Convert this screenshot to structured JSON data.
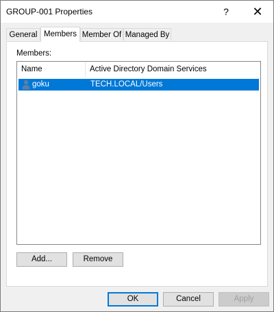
{
  "window": {
    "title": "GROUP-001 Properties",
    "help_label": "?",
    "close_label": "✕"
  },
  "tabs": [
    {
      "label": "General"
    },
    {
      "label": "Members"
    },
    {
      "label": "Member Of"
    },
    {
      "label": "Managed By"
    }
  ],
  "active_tab": "Members",
  "members": {
    "label": "Members:",
    "columns": [
      "Name",
      "Active Directory Domain Services Folder"
    ],
    "rows": [
      {
        "name": "goku",
        "folder": "TECH.LOCAL/Users",
        "icon": "user-icon",
        "selected": true
      }
    ],
    "add_label": "Add...",
    "remove_label": "Remove"
  },
  "footer": {
    "ok_label": "OK",
    "cancel_label": "Cancel",
    "apply_label": "Apply"
  },
  "colors": {
    "selection": "#0078d7",
    "window_bg": "#f0f0f0",
    "button_bg": "#e1e1e1",
    "disabled_text": "#a0a0a0"
  }
}
